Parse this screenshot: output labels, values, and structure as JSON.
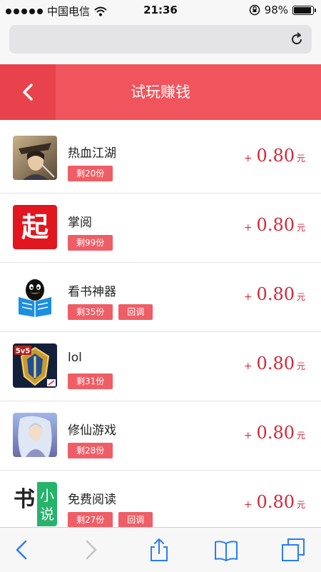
{
  "status_bar": {
    "carrier": "中国电信",
    "time": "21:36",
    "battery": "98%",
    "battery_level": 0.98
  },
  "header": {
    "title": "试玩赚钱"
  },
  "tasks": [
    {
      "name": "热血江湖",
      "tags": [
        "剩20份"
      ],
      "plus": "+",
      "amount": "0.80",
      "unit": "元",
      "icon": "game-warrior-icon"
    },
    {
      "name": "掌阅",
      "tags": [
        "剩99份"
      ],
      "plus": "+",
      "amount": "0.80",
      "unit": "元",
      "icon": "qi-reader-icon"
    },
    {
      "name": "看书神器",
      "tags": [
        "剩35份",
        "回调"
      ],
      "plus": "+",
      "amount": "0.80",
      "unit": "元",
      "icon": "qq-penguin-book-icon"
    },
    {
      "name": "lol",
      "tags": [
        "剩31份"
      ],
      "plus": "+",
      "amount": "0.80",
      "unit": "元",
      "icon": "5v5-shield-icon"
    },
    {
      "name": "修仙游戏",
      "tags": [
        "剩28份"
      ],
      "plus": "+",
      "amount": "0.80",
      "unit": "元",
      "icon": "fantasy-character-icon"
    },
    {
      "name": "免费阅读",
      "tags": [
        "剩27份",
        "回调"
      ],
      "plus": "+",
      "amount": "0.80",
      "unit": "元",
      "icon": "novel-book-icon"
    }
  ],
  "icons": {
    "row1": "热血江湖",
    "row2": "起",
    "row4": "5v5",
    "row6_a": "书",
    "row6_b": "小",
    "row6_c": "说"
  },
  "colors": {
    "header": "#f0545c",
    "back_button": "#e8434c",
    "tag": "#ef5e66",
    "reward": "#d4283a"
  }
}
